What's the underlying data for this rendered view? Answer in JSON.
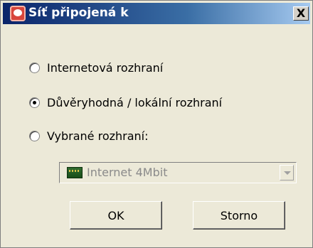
{
  "window": {
    "title": "Síť připojená k",
    "close_label": "X"
  },
  "options": [
    {
      "label": "Internetová rozhraní",
      "checked": false
    },
    {
      "label": "Důvěryhodná / lokální rozhraní",
      "checked": true
    },
    {
      "label": "Vybrané rozhraní:",
      "checked": false
    }
  ],
  "interface_select": {
    "value": "Internet 4Mbit",
    "icon": "network-card-icon",
    "disabled": true
  },
  "buttons": {
    "ok": "OK",
    "cancel": "Storno"
  }
}
